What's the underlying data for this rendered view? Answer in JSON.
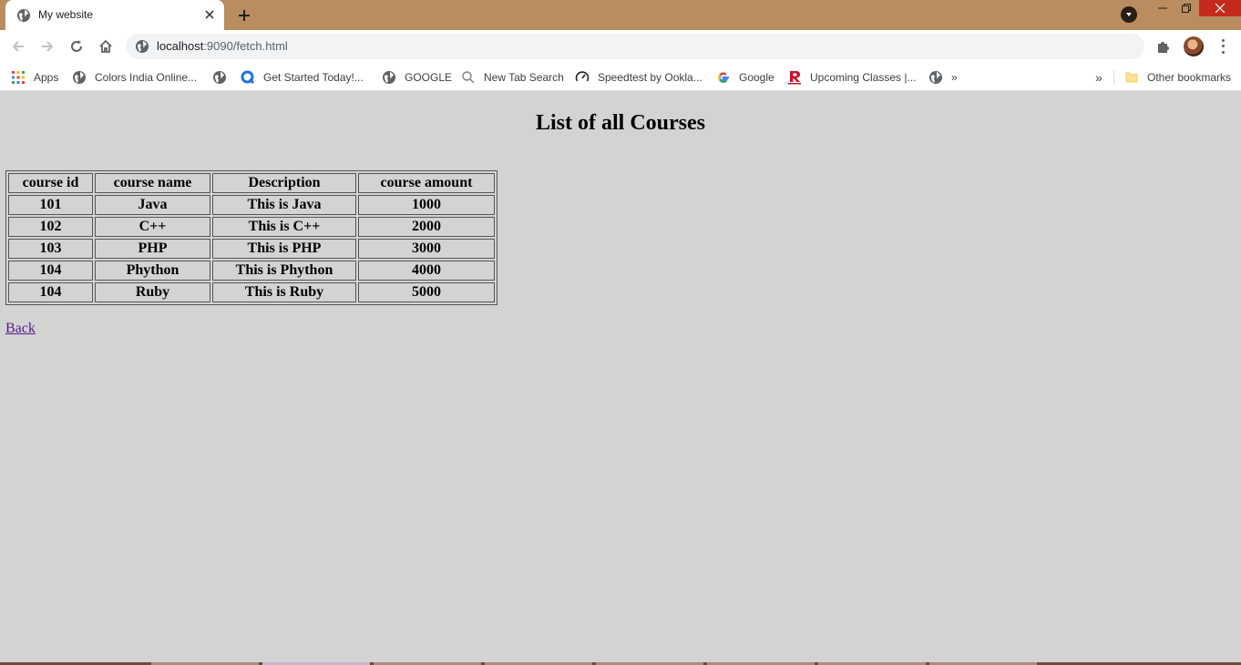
{
  "browser": {
    "tab": {
      "title": "My website"
    },
    "address_bar": {
      "host": "localhost",
      "path": ":9090/fetch.html"
    },
    "bookmarks": [
      {
        "label": "Apps",
        "icon": "apps-grid-icon"
      },
      {
        "label": "Colors India Online...",
        "icon": "globe-icon"
      },
      {
        "label": "",
        "icon": "globe-icon"
      },
      {
        "label": "Get Started Today!...",
        "icon": "q-logo-icon"
      },
      {
        "label": "GOOGLE",
        "icon": "globe-icon"
      },
      {
        "label": "New Tab Search",
        "icon": "search-icon"
      },
      {
        "label": "Speedtest by Ookla...",
        "icon": "speedometer-icon"
      },
      {
        "label": "Google",
        "icon": "google-g-icon"
      },
      {
        "label": "Upcoming Classes |...",
        "icon": "r-logo-icon"
      },
      {
        "label": "»",
        "icon": "globe-icon"
      }
    ],
    "overflow_label": "»",
    "other_bookmarks": "Other bookmarks",
    "colors": {
      "frame": "#b98d5f",
      "close_button": "#c42b1c",
      "page_background": "#d3d3d3",
      "link_visited": "#551a8b"
    }
  },
  "page": {
    "heading": "List of all Courses",
    "table": {
      "headers": [
        "course id",
        "course name",
        "Description",
        "course amount"
      ],
      "rows": [
        [
          "101",
          "Java",
          "This is Java",
          "1000"
        ],
        [
          "102",
          "C++",
          "This is C++",
          "2000"
        ],
        [
          "103",
          "PHP",
          "This is PHP",
          "3000"
        ],
        [
          "104",
          "Phython",
          "This is Phython",
          "4000"
        ],
        [
          "104",
          "Ruby",
          "This is Ruby",
          "5000"
        ]
      ]
    },
    "back_link": "Back"
  }
}
